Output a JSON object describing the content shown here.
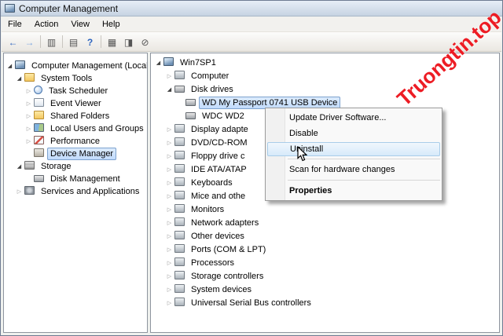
{
  "window": {
    "title": "Computer Management"
  },
  "menu": {
    "items": [
      {
        "label": "File"
      },
      {
        "label": "Action"
      },
      {
        "label": "View"
      },
      {
        "label": "Help"
      }
    ]
  },
  "toolbar": {
    "icons": [
      {
        "name": "back-icon",
        "glyph": "←"
      },
      {
        "name": "forward-icon",
        "glyph": "→"
      },
      {
        "name": "show-console-tree-icon",
        "glyph": "▥"
      },
      {
        "name": "export-list-icon",
        "glyph": "▤"
      },
      {
        "name": "help-icon",
        "glyph": "?"
      },
      {
        "name": "scan-hardware-icon",
        "glyph": "▦"
      },
      {
        "name": "update-driver-icon",
        "glyph": "◨"
      },
      {
        "name": "disable-device-icon",
        "glyph": "⊘"
      }
    ]
  },
  "sidebar": {
    "items": [
      {
        "label": "Computer Management (Local"
      },
      {
        "label": "System Tools"
      },
      {
        "label": "Task Scheduler"
      },
      {
        "label": "Event Viewer"
      },
      {
        "label": "Shared Folders"
      },
      {
        "label": "Local Users and Groups"
      },
      {
        "label": "Performance"
      },
      {
        "label": "Device Manager"
      },
      {
        "label": "Storage"
      },
      {
        "label": "Disk Management"
      },
      {
        "label": "Services and Applications"
      }
    ]
  },
  "device_tree": {
    "items": [
      {
        "label": "Win7SP1"
      },
      {
        "label": "Computer"
      },
      {
        "label": "Disk drives"
      },
      {
        "label": "WD My Passport 0741 USB Device"
      },
      {
        "label": "WDC WD2"
      },
      {
        "label": "Display adapte"
      },
      {
        "label": "DVD/CD-ROM"
      },
      {
        "label": "Floppy drive c"
      },
      {
        "label": "IDE ATA/ATAP"
      },
      {
        "label": "Keyboards"
      },
      {
        "label": "Mice and othe"
      },
      {
        "label": "Monitors"
      },
      {
        "label": "Network adapters"
      },
      {
        "label": "Other devices"
      },
      {
        "label": "Ports (COM & LPT)"
      },
      {
        "label": "Processors"
      },
      {
        "label": "Storage controllers"
      },
      {
        "label": "System devices"
      },
      {
        "label": "Universal Serial Bus controllers"
      }
    ]
  },
  "context_menu": {
    "items": [
      {
        "label": "Update Driver Software..."
      },
      {
        "label": "Disable"
      },
      {
        "label": "Uninstall"
      },
      {
        "label": "Scan for hardware changes"
      },
      {
        "label": "Properties"
      }
    ]
  },
  "watermark": {
    "text": "Truongtin.top",
    "color": "#ed1c24"
  },
  "colors": {
    "selection_border": "#7da2ce",
    "selection_fill": "#c1dbfc",
    "menu_highlight_border": "#a9cde9",
    "titlebar": "#c6d3e2"
  }
}
